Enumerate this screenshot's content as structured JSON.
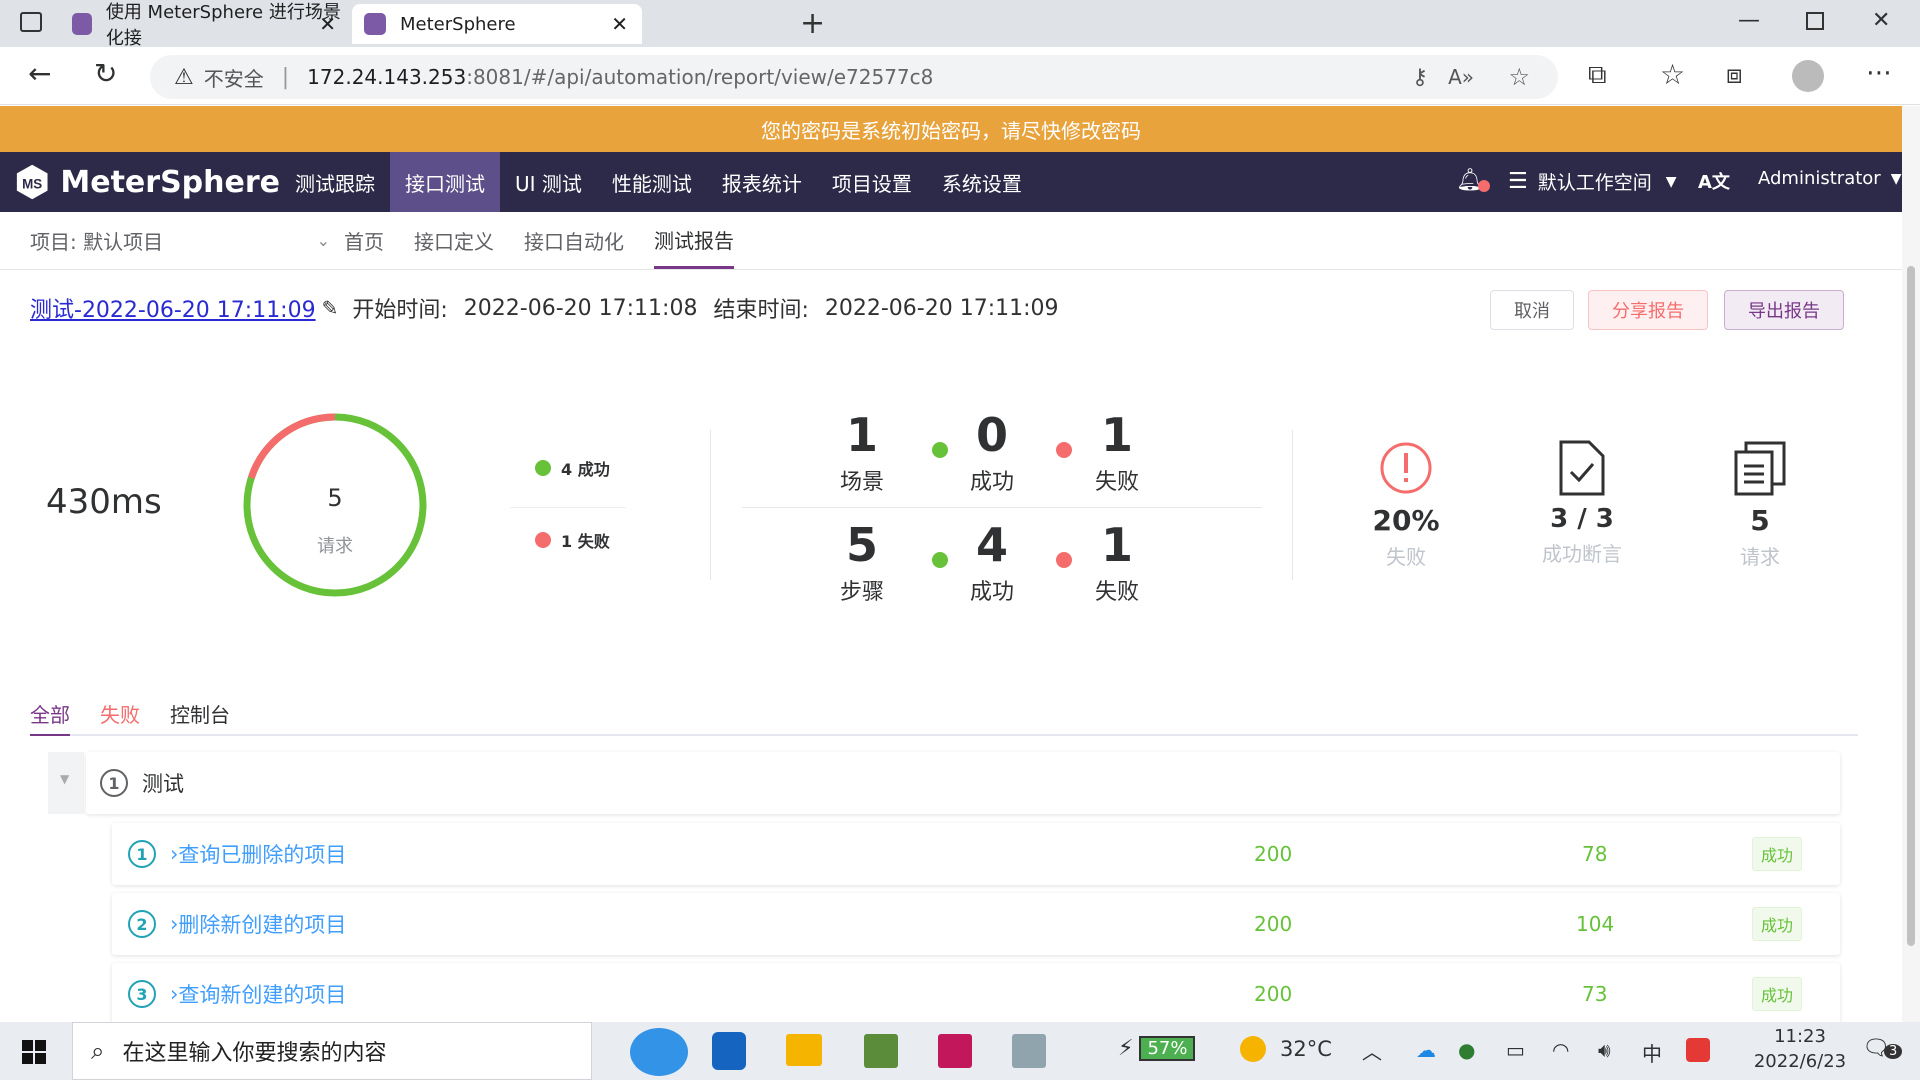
{
  "browser": {
    "tabs": [
      {
        "title": "使用 MeterSphere 进行场景化接"
      },
      {
        "title": "MeterSphere"
      }
    ],
    "security": "不安全",
    "url_host": "172.24.143.253",
    "url_rest": ":8081/#/api/automation/report/view/e72577c8"
  },
  "banner": "您的密码是系统初始密码，请尽快修改密码",
  "app": {
    "logo": "MeterSphere",
    "nav": [
      "测试跟踪",
      "接口测试",
      "UI 测试",
      "性能测试",
      "报表统计",
      "项目设置",
      "系统设置"
    ],
    "active_nav": 1,
    "workspace": "默认工作空间",
    "user": "Administrator"
  },
  "subnav": {
    "project": "项目: 默认项目",
    "items": [
      "首页",
      "接口定义",
      "接口自动化",
      "测试报告"
    ],
    "active": 3
  },
  "report": {
    "name": "测试-2022-06-20 17:11:09 ",
    "start_label": "开始时间:",
    "start": "2022-06-20 17:11:08",
    "end_label": "结束时间:",
    "end": "2022-06-20 17:11:09",
    "btn_cancel": "取消",
    "btn_share": "分享报告",
    "btn_export": "导出报告"
  },
  "summary": {
    "duration": "430ms",
    "ring_count": "5",
    "ring_label": "请求",
    "ring_success_fraction": 0.8,
    "legend_success": "4 成功",
    "legend_fail": "1 失败",
    "scenario": {
      "total": "1",
      "total_label": "场景",
      "success": "0",
      "success_label": "成功",
      "fail": "1",
      "fail_label": "失败"
    },
    "step": {
      "total": "5",
      "total_label": "步骤",
      "success": "4",
      "success_label": "成功",
      "fail": "1",
      "fail_label": "失败"
    },
    "fail_rate": "20%",
    "fail_rate_label": "失败",
    "assert": "3 / 3",
    "assert_label": "成功断言",
    "requests": "5",
    "requests_label": "请求"
  },
  "tabs": [
    "全部",
    "失败",
    "控制台"
  ],
  "tree": {
    "root": {
      "index": "1",
      "name": "测试"
    },
    "rows": [
      {
        "index": "1",
        "name": "查询已删除的项目",
        "code": "200",
        "time": "78",
        "status": "成功"
      },
      {
        "index": "2",
        "name": "删除新创建的项目",
        "code": "200",
        "time": "104",
        "status": "成功"
      },
      {
        "index": "3",
        "name": "查询新创建的项目",
        "code": "200",
        "time": "73",
        "status": "成功"
      }
    ]
  },
  "taskbar": {
    "search": "在这里输入你要搜索的内容",
    "battery": "57%",
    "temp": "32°C",
    "time": "11:23",
    "date": "2022/6/23",
    "notif": "3",
    "ime": "中"
  },
  "colors": {
    "nav_bg": "#2c2a48",
    "active_nav": "#5d4f8a",
    "banner": "#e8a33d",
    "success": "#67c23a",
    "fail": "#f56c6c",
    "link": "#409eff",
    "accent": "#783887"
  }
}
